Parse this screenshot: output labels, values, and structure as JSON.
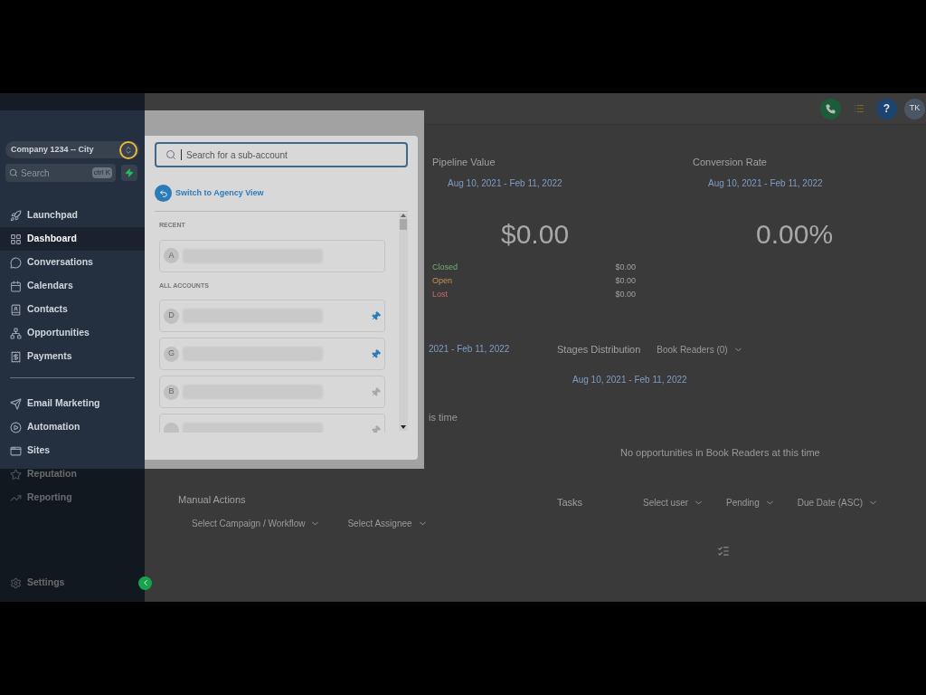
{
  "sidebar": {
    "account": "Company 1234 -- City",
    "search": {
      "placeholder": "Search",
      "shortcut": "ctrl K"
    },
    "groups": [
      [
        {
          "label": "Launchpad",
          "selected": false
        },
        {
          "label": "Dashboard",
          "selected": true
        },
        {
          "label": "Conversations",
          "selected": false
        },
        {
          "label": "Calendars",
          "selected": false
        },
        {
          "label": "Contacts",
          "selected": false
        },
        {
          "label": "Opportunities",
          "selected": false
        },
        {
          "label": "Payments",
          "selected": false
        }
      ],
      [
        {
          "label": "Email Marketing",
          "selected": false
        },
        {
          "label": "Automation",
          "selected": false
        },
        {
          "label": "Sites",
          "selected": false
        },
        {
          "label": "Reputation",
          "selected": false
        },
        {
          "label": "Reporting",
          "selected": false
        }
      ]
    ],
    "settings": "Settings"
  },
  "account_switcher": {
    "search_placeholder": "Search for a sub-account",
    "switch_link": "Switch to Agency View",
    "sections": [
      {
        "heading": "RECENT",
        "accounts": [
          {
            "initial": "A"
          }
        ]
      },
      {
        "heading": "ALL ACCOUNTS",
        "accounts": [
          {
            "initial": "D",
            "pinned": true
          },
          {
            "initial": "G",
            "pinned": true
          },
          {
            "initial": "B",
            "pinned": false
          },
          {
            "pinned": false
          }
        ]
      }
    ]
  },
  "header": {
    "help": "?",
    "avatar": "TK"
  },
  "cards": {
    "pipeline": {
      "title": "Pipeline Value",
      "date": "Aug 10, 2021 - Feb 11, 2022",
      "value": "$0.00",
      "rows": [
        {
          "label": "Closed",
          "amount": "$0.00"
        },
        {
          "label": "Open",
          "amount": "$0.00"
        },
        {
          "label": "Lost",
          "amount": "$0.00"
        }
      ]
    },
    "conversion": {
      "title": "Conversion Rate",
      "date": "Aug 10, 2021 - Feb 11, 2022",
      "value": "0.00%"
    },
    "hidden_card": {
      "date": "2021 - Feb 11, 2022",
      "message": "is time"
    },
    "stages": {
      "title": "Stages Distribution",
      "pipeline": "Book Readers (0)",
      "date": "Aug 10, 2021 - Feb 11, 2022",
      "message": "No opportunities in Book Readers at this time"
    },
    "manual_actions": {
      "title": "Manual Actions",
      "selects": [
        "Select Campaign / Workflow",
        "Select Assignee"
      ]
    },
    "tasks": {
      "title": "Tasks",
      "selects": [
        "Select user",
        "Pending",
        "Due Date (ASC)"
      ]
    }
  }
}
